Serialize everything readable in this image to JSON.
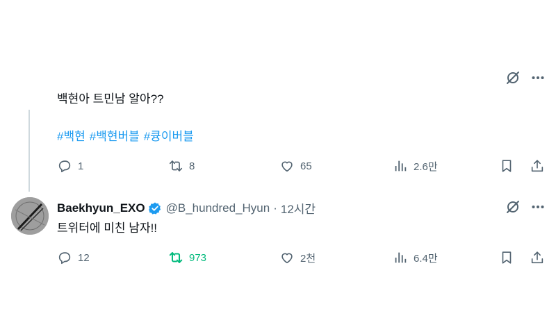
{
  "tweet1": {
    "text": "백현아 트민남 알아??",
    "hashtags": [
      "#백현",
      "#백현버블",
      "#큥이버블"
    ],
    "actions": {
      "replies": "1",
      "retweets": "8",
      "likes": "65",
      "views": "2.6만"
    }
  },
  "tweet2": {
    "display_name": "Baekhyun_EXO",
    "handle": "@B_hundred_Hyun",
    "separator": "·",
    "time": "12시간",
    "text": "트위터에 미친 남자!!",
    "actions": {
      "replies": "12",
      "retweets": "973",
      "likes": "2천",
      "views": "6.4만"
    }
  },
  "colors": {
    "text": "#0f1419",
    "secondary": "#536471",
    "link": "#1d9bf0",
    "retweet_active": "#00ba7c",
    "verified": "#1d9bf0",
    "thread_line": "#cfd9de"
  },
  "icons": [
    "grok-icon",
    "more-icon",
    "reply-icon",
    "retweet-icon",
    "like-icon",
    "views-icon",
    "bookmark-icon",
    "share-icon",
    "verified-badge-icon"
  ]
}
